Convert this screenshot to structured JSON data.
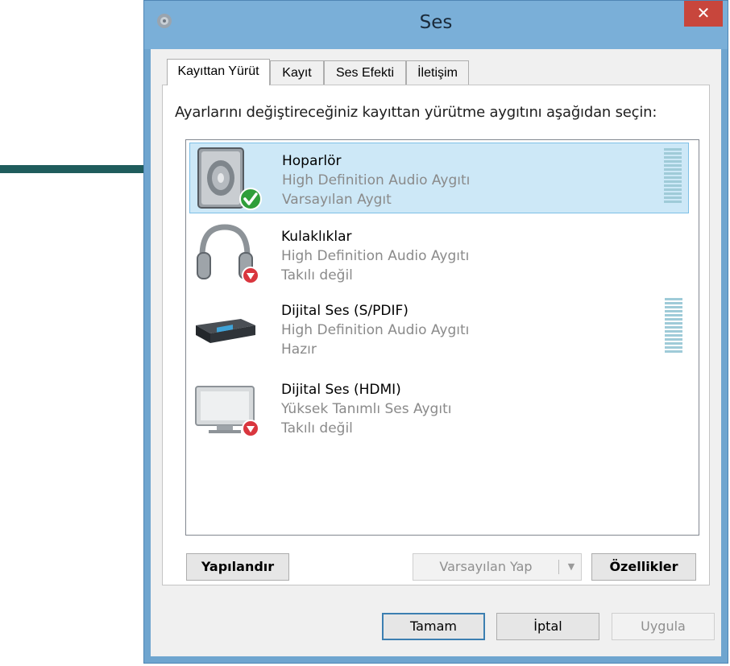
{
  "window": {
    "title": "Ses",
    "close_label": "✕"
  },
  "tabs": [
    {
      "label": "Kayıttan Yürüt",
      "active": true
    },
    {
      "label": "Kayıt",
      "active": false
    },
    {
      "label": "Ses Efekti",
      "active": false
    },
    {
      "label": "İletişim",
      "active": false
    }
  ],
  "instruction": "Ayarlarını değiştireceğiniz kayıttan yürütme aygıtını aşağıdan seçin:",
  "devices": [
    {
      "name": "Hoparlör",
      "driver": "High Definition Audio Aygıtı",
      "status": "Varsayılan Aygıt",
      "icon": "speaker-icon",
      "badge": "check-badge",
      "selected": true
    },
    {
      "name": "Kulaklıklar",
      "driver": "High Definition Audio Aygıtı",
      "status": "Takılı değil",
      "icon": "headphones-icon",
      "badge": "unplugged-badge",
      "selected": false
    },
    {
      "name": "Dijital Ses (S/PDIF)",
      "driver": "High Definition Audio Aygıtı",
      "status": "Hazır",
      "icon": "spdif-receiver-icon",
      "badge": "",
      "selected": false
    },
    {
      "name": "Dijital Ses (HDMI)",
      "driver": "Yüksek Tanımlı Ses Aygıtı",
      "status": "Takılı değil",
      "icon": "hdmi-monitor-icon",
      "badge": "unplugged-badge",
      "selected": false
    }
  ],
  "buttons": {
    "configure": "Yapılandır",
    "set_default": "Varsayılan Yap",
    "properties": "Özellikler",
    "ok": "Tamam",
    "cancel": "İptal",
    "apply": "Uygula"
  },
  "colors": {
    "selection": "#cde8f7",
    "titlebar": "#7aafd8",
    "close": "#c8463c",
    "arrow": "#1f5c5c"
  }
}
